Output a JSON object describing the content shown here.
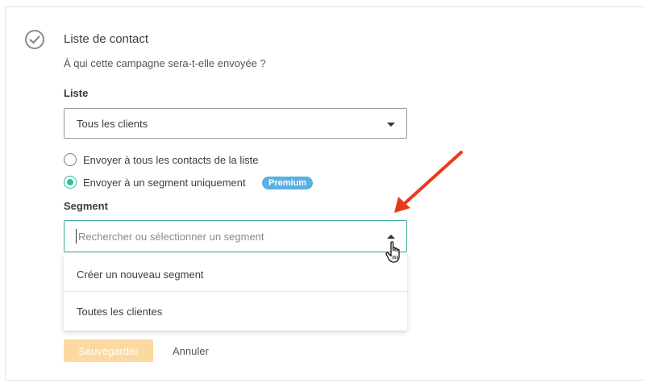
{
  "section": {
    "title": "Liste de contact",
    "subtitle": "À qui cette campagne sera-t-elle envoyée ?"
  },
  "list_field": {
    "label": "Liste",
    "selected_value": "Tous les clients"
  },
  "send_options": {
    "all_label": "Envoyer à tous les contacts de la liste",
    "segment_label": "Envoyer à un segment uniquement",
    "selected": "segment",
    "premium_badge": "Premium"
  },
  "segment_field": {
    "label": "Segment",
    "placeholder": "Rechercher ou sélectionner un segment",
    "value": "",
    "options": [
      "Créer un nouveau segment",
      "Toutes les clientes"
    ]
  },
  "actions": {
    "save_label": "Sauvegarder",
    "cancel_label": "Annuler"
  },
  "colors": {
    "accent": "#2fbf9f",
    "input_focus_border": "#3aa999",
    "premium_badge": "#5ab0e0",
    "save_button_disabled": "#fbd9a0",
    "annotation_arrow": "#e8391d"
  },
  "icons": {
    "section_status": "check-circle-icon",
    "cursor": "hand-pointer-icon",
    "annotation": "red-arrow-icon"
  }
}
